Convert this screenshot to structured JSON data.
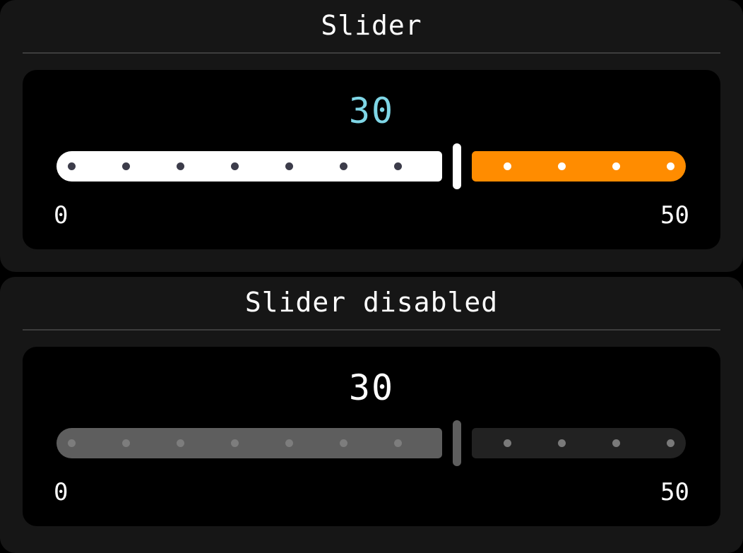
{
  "slider": {
    "title": "Slider",
    "value": "30",
    "min_label": "0",
    "max_label": "50",
    "value_fraction": 0.6,
    "left_dots": 7,
    "right_dots": 4
  },
  "slider_disabled": {
    "title": "Slider disabled",
    "value": "30",
    "min_label": "0",
    "max_label": "50",
    "value_fraction": 0.6,
    "left_dots": 7,
    "right_dots": 4
  },
  "colors": {
    "background": "#000000",
    "panel": "#161616",
    "value_active": "#7fd6e6",
    "track_filled_active": "#ffffff",
    "track_remaining_active": "#ff8c00",
    "track_filled_disabled": "#5e5e5e",
    "track_remaining_disabled": "#222222"
  }
}
